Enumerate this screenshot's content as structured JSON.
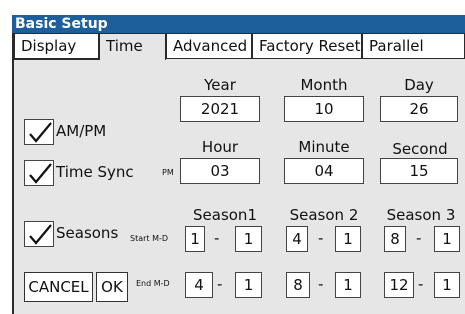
{
  "title": "Basic Setup",
  "tabs": [
    "Display",
    "Time",
    "Advanced",
    "Factory Reset",
    "Parallel"
  ],
  "active_tab": "Time",
  "date": {
    "year_label": "Year",
    "month_label": "Month",
    "day_label": "Day",
    "year": "2021",
    "month": "10",
    "day": "26"
  },
  "ampm": {
    "label": "AM/PM",
    "checked": true
  },
  "time": {
    "hour_label": "Hour",
    "minute_label": "Minute",
    "second_label": "Second",
    "meridiem": "PM",
    "hour": "03",
    "minute": "04",
    "second": "15"
  },
  "time_sync": {
    "label": "Time Sync",
    "checked": true
  },
  "seasons": {
    "label": "Seasons",
    "checked": true,
    "start_label": "Start M-D",
    "end_label": "End M-D",
    "season1": {
      "label": "Season1",
      "start_m": "1",
      "start_d": "1",
      "end_m": "4",
      "end_d": "1"
    },
    "season2": {
      "label": "Season 2",
      "start_m": "4",
      "start_d": "1",
      "end_m": "8",
      "end_d": "1"
    },
    "season3": {
      "label": "Season 3",
      "start_m": "8",
      "start_d": "1",
      "end_m": "12",
      "end_d": "1"
    },
    "separator": "-"
  },
  "buttons": {
    "cancel": "CANCEL",
    "ok": "OK"
  },
  "icons": {
    "checkmark": "checkmark-icon"
  },
  "colors": {
    "title_bar": "#1d5f9b",
    "panel": "#e6e6e6"
  }
}
